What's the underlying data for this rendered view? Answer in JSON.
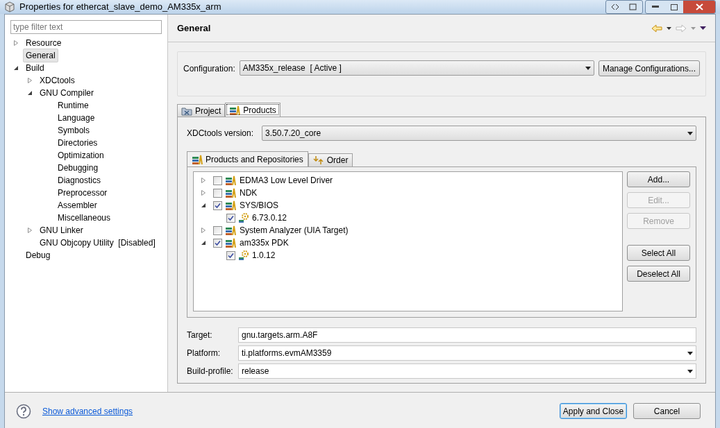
{
  "window": {
    "title": "Properties for ethercat_slave_demo_AM335x_arm"
  },
  "sidebar": {
    "filter_placeholder": "type filter text",
    "items": [
      {
        "label": "Resource",
        "selected": false,
        "expanded": false
      },
      {
        "label": "General",
        "selected": true
      },
      {
        "label": "Build",
        "selected": false,
        "expanded": true,
        "children": [
          {
            "label": "XDCtools",
            "selected": false,
            "expanded": false
          },
          {
            "label": "GNU Compiler",
            "selected": false,
            "expanded": true,
            "children": [
              {
                "label": "Runtime",
                "selected": false
              },
              {
                "label": "Language",
                "selected": false
              },
              {
                "label": "Symbols",
                "selected": false
              },
              {
                "label": "Directories",
                "selected": false
              },
              {
                "label": "Optimization",
                "selected": false
              },
              {
                "label": "Debugging",
                "selected": false
              },
              {
                "label": "Diagnostics",
                "selected": false
              },
              {
                "label": "Preprocessor",
                "selected": false
              },
              {
                "label": "Assembler",
                "selected": false
              },
              {
                "label": "Miscellaneous",
                "selected": false
              }
            ]
          },
          {
            "label": "GNU Linker",
            "selected": false,
            "expanded": false
          },
          {
            "label": "GNU Objcopy Utility  [Disabled]",
            "selected": false
          }
        ]
      },
      {
        "label": "Debug",
        "selected": false
      }
    ]
  },
  "page": {
    "title": "General",
    "configuration": {
      "label": "Configuration:",
      "value": "AM335x_release  [ Active ]",
      "button": "Manage Configurations..."
    },
    "tabs": [
      {
        "label": "Project",
        "selected": false,
        "kind": "project"
      },
      {
        "label": "Products",
        "selected": true,
        "kind": "products"
      }
    ],
    "xdctools": {
      "label": "XDCtools version:",
      "value": "3.50.7.20_core"
    },
    "inner_tabs": [
      {
        "label": "Products and Repositories",
        "selected": true,
        "kind": "products"
      },
      {
        "label": "Order",
        "selected": false,
        "kind": "order"
      }
    ],
    "products": [
      {
        "label": "EDMA3 Low Level Driver",
        "checked": false,
        "expanded": false
      },
      {
        "label": "NDK",
        "checked": false,
        "expanded": false
      },
      {
        "label": "SYS/BIOS",
        "checked": true,
        "expanded": true,
        "children": [
          {
            "label": "6.73.0.12",
            "checked": true
          }
        ]
      },
      {
        "label": "System Analyzer (UIA Target)",
        "checked": false,
        "expanded": false
      },
      {
        "label": "am335x PDK",
        "checked": true,
        "expanded": true,
        "children": [
          {
            "label": "1.0.12",
            "checked": true
          }
        ]
      }
    ],
    "side_buttons": [
      {
        "label": "Add...",
        "disabled": false
      },
      {
        "label": "Edit...",
        "disabled": true
      },
      {
        "label": "Remove",
        "disabled": true
      },
      {
        "label": "Select All",
        "disabled": false
      },
      {
        "label": "Deselect All",
        "disabled": false
      }
    ],
    "fields": [
      {
        "label": "Target:",
        "value": "gnu.targets.arm.A8F",
        "kind": "text"
      },
      {
        "label": "Platform:",
        "value": "ti.platforms.evmAM3359",
        "kind": "combo"
      },
      {
        "label": "Build-profile:",
        "value": "release",
        "kind": "combo"
      }
    ]
  },
  "footer": {
    "link": "Show advanced settings",
    "buttons": [
      {
        "label": "Apply and Close",
        "default": true
      },
      {
        "label": "Cancel",
        "default": false
      }
    ]
  }
}
